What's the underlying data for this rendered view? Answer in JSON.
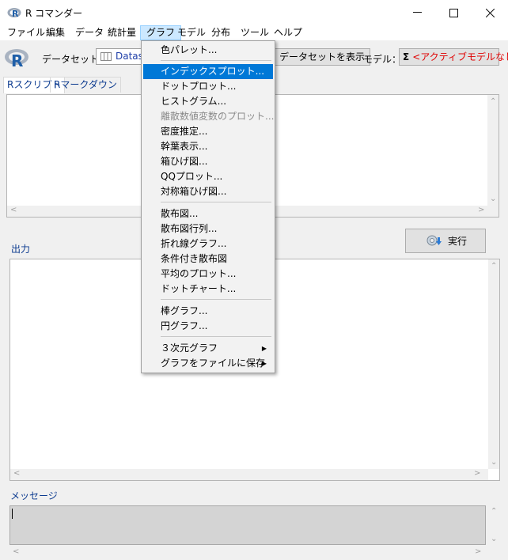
{
  "window": {
    "title": "R コマンダー"
  },
  "menubar": [
    {
      "label": "ファイル"
    },
    {
      "label": "編集"
    },
    {
      "label": "データ"
    },
    {
      "label": "統計量"
    },
    {
      "label": "グラフ"
    },
    {
      "label": "モデル"
    },
    {
      "label": "分布"
    },
    {
      "label": "ツール"
    },
    {
      "label": "ヘルプ"
    }
  ],
  "toolbar": {
    "dataset_label": "データセット：",
    "dataset_value": "Datase",
    "show_dataset_button": "データセットを表示",
    "model_label": "モデル：",
    "model_sigma": "Σ",
    "model_value": "<アクティブモデルなし>"
  },
  "tabs": [
    {
      "label": "Rスクリプト"
    },
    {
      "label": "Rマークダウン"
    }
  ],
  "output_label": "出力",
  "run_button": "実行",
  "messages_label": "メッセージ",
  "graph_menu": {
    "items": [
      {
        "label": "色パレット..."
      },
      {
        "label": "インデックスプロット..."
      },
      {
        "label": "ドットプロット..."
      },
      {
        "label": "ヒストグラム..."
      },
      {
        "label": "離散数値変数のプロット..."
      },
      {
        "label": "密度推定..."
      },
      {
        "label": "幹葉表示..."
      },
      {
        "label": "箱ひげ図..."
      },
      {
        "label": "QQプロット..."
      },
      {
        "label": "対称箱ひげ図..."
      },
      {
        "label": "散布図..."
      },
      {
        "label": "散布図行列..."
      },
      {
        "label": "折れ線グラフ..."
      },
      {
        "label": "条件付き散布図"
      },
      {
        "label": "平均のプロット..."
      },
      {
        "label": "ドットチャート..."
      },
      {
        "label": "棒グラフ..."
      },
      {
        "label": "円グラフ..."
      },
      {
        "label": "３次元グラフ"
      },
      {
        "label": "グラフをファイルに保存"
      }
    ]
  },
  "colors": {
    "highlight": "#0078d7",
    "label_blue": "#0b3a8f",
    "model_red": "#e00000"
  }
}
